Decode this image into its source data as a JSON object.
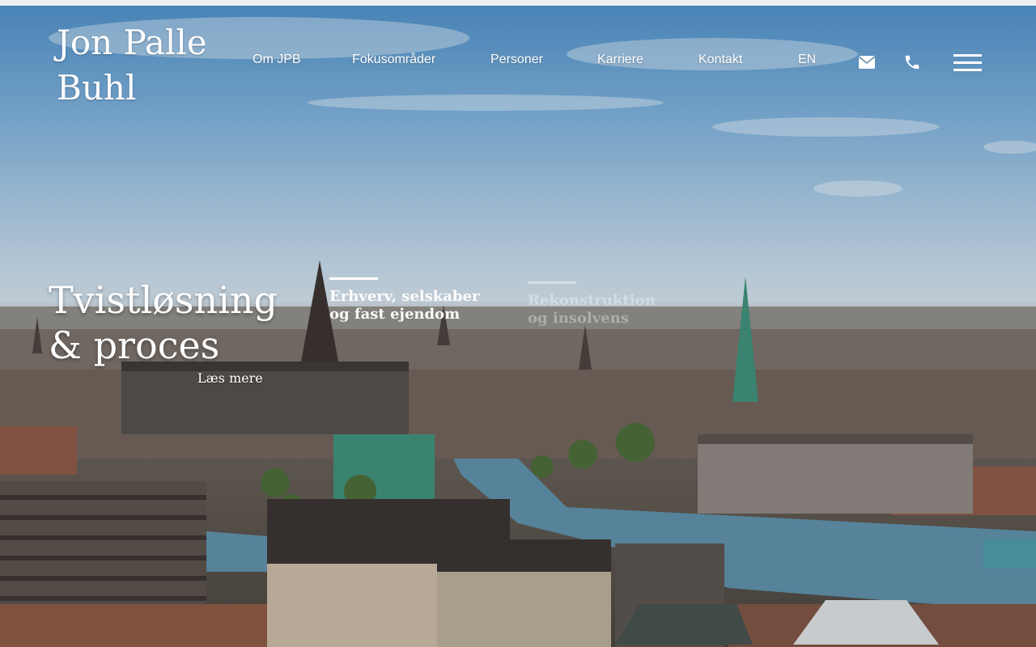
{
  "site": {
    "logo_line1": "Jon Palle",
    "logo_line2": "Buhl"
  },
  "nav": {
    "items": [
      {
        "label": "Om JPB"
      },
      {
        "label": "Fokusområder"
      },
      {
        "label": "Personer"
      },
      {
        "label": "Karriere"
      },
      {
        "label": "Kontakt"
      },
      {
        "label": "EN"
      }
    ],
    "icons": [
      "envelope-icon",
      "phone-icon",
      "hamburger-menu-icon"
    ]
  },
  "hero": {
    "title_line1": "Tvistløsning",
    "title_line2": "& proces",
    "read_more": "Læs mere",
    "tabs": [
      {
        "line1": "Erhverv, selskaber",
        "line2": "og fast ejendom",
        "active": true
      },
      {
        "line1": "Rekonstruktion",
        "line2": "og insolvens",
        "active": false
      }
    ]
  },
  "colors": {
    "text": "#ffffff",
    "sky_top": "#4f8fc6",
    "water": "#5e8ea8",
    "roof_copper": "#3f8f7a",
    "brick": "#9c5a44"
  }
}
